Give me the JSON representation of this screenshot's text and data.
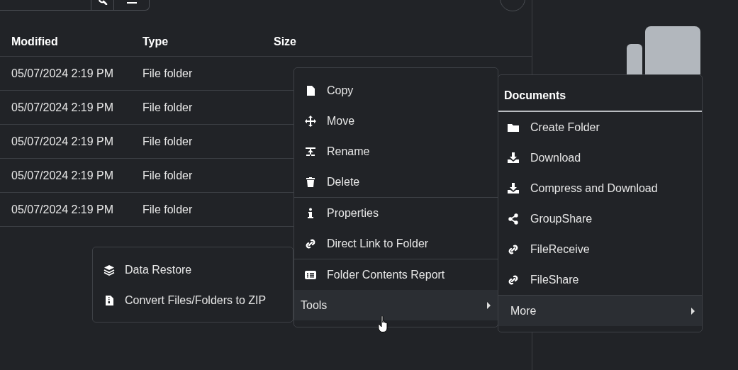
{
  "table": {
    "columns": [
      "Modified",
      "Type",
      "Size"
    ],
    "rows": [
      [
        "05/07/2024 2:19 PM",
        "File folder"
      ],
      [
        "05/07/2024 2:19 PM",
        "File folder"
      ],
      [
        "05/07/2024 2:19 PM",
        "File folder"
      ],
      [
        "05/07/2024 2:19 PM",
        "File folder"
      ],
      [
        "05/07/2024 2:19 PM",
        "File folder"
      ]
    ]
  },
  "tools_menu": {
    "items": [
      {
        "label": "Data Restore",
        "highlighted": false
      },
      {
        "label": "Convert Files/Folders to ZIP",
        "highlighted": false
      }
    ]
  },
  "context_menu": {
    "sections": [
      {
        "items": [
          {
            "label": "Copy",
            "kind": "action",
            "highlighted": false
          },
          {
            "label": "Move",
            "kind": "action",
            "highlighted": false
          },
          {
            "label": "Rename",
            "kind": "action",
            "highlighted": false
          },
          {
            "label": "Delete",
            "kind": "action",
            "highlighted": false
          }
        ]
      },
      {
        "items": [
          {
            "label": "Properties",
            "kind": "action",
            "highlighted": false
          },
          {
            "label": "Direct Link to Folder",
            "kind": "action",
            "highlighted": false
          }
        ]
      },
      {
        "items": [
          {
            "label": "Folder Contents Report",
            "kind": "action",
            "highlighted": false
          },
          {
            "label": "Tools",
            "kind": "submenu",
            "highlighted": true
          }
        ]
      }
    ]
  },
  "documents_menu": {
    "title": "Documents",
    "sections": [
      {
        "items": [
          {
            "label": "Create Folder",
            "kind": "action",
            "highlighted": false
          },
          {
            "label": "Download",
            "kind": "action",
            "highlighted": false
          },
          {
            "label": "Compress and Download",
            "kind": "action",
            "highlighted": false
          },
          {
            "label": "GroupShare",
            "kind": "action",
            "highlighted": false
          },
          {
            "label": "FileReceive",
            "kind": "action",
            "highlighted": false
          },
          {
            "label": "FileShare",
            "kind": "action",
            "highlighted": false
          }
        ]
      },
      {
        "items": [
          {
            "label": "More",
            "kind": "submenu",
            "highlighted": true
          }
        ]
      }
    ]
  }
}
